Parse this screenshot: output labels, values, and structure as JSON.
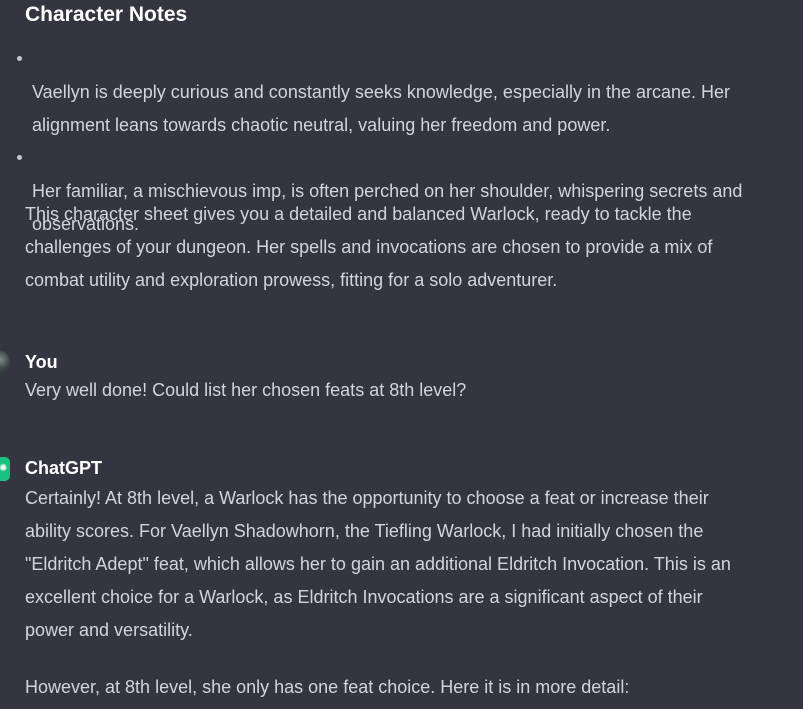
{
  "character_notes": {
    "title": "Character Notes",
    "bullets": [
      "Vaellyn is deeply curious and constantly seeks knowledge, especially in the arcane. Her\nalignment leans towards chaotic neutral, valuing her freedom and power.",
      "Her familiar, a mischievous imp, is often perched on her shoulder, whispering secrets and\nobservations."
    ],
    "summary": "This character sheet gives you a detailed and balanced Warlock, ready to tackle the\nchallenges of your dungeon. Her spells and invocations are chosen to provide a mix of\ncombat utility and exploration prowess, fitting for a solo adventurer."
  },
  "user_message": {
    "author": "You",
    "text": "Very well done! Could list her chosen feats at 8th level?"
  },
  "assistant_message": {
    "author": "ChatGPT",
    "paragraph_1": "Certainly! At 8th level, a Warlock has the opportunity to choose a feat or increase their\nability scores. For Vaellyn Shadowhorn, the Tiefling Warlock, I had initially chosen the\n\"Eldritch Adept\" feat, which allows her to gain an additional Eldritch Invocation. This is an\nexcellent choice for a Warlock, as Eldritch Invocations are a significant aspect of their\npower and versatility.",
    "paragraph_2": "However, at 8th level, she only has one feat choice. Here it is in more detail:"
  },
  "colors": {
    "background": "#343541",
    "assistant_avatar": "#19c37d"
  }
}
